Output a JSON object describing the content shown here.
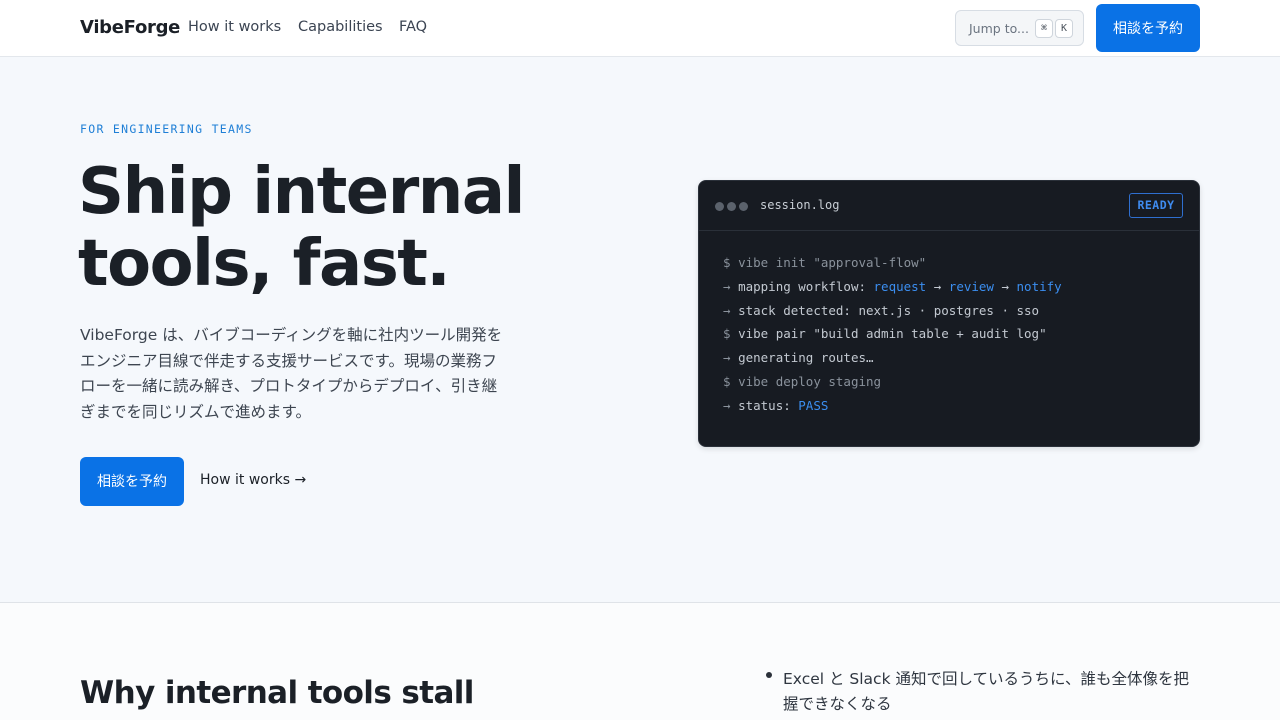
{
  "header": {
    "brand": "VibeForge",
    "nav": [
      "How it works",
      "Capabilities",
      "FAQ"
    ],
    "jump": {
      "label": "Jump to...",
      "key1": "⌘",
      "key2": "K"
    },
    "cta": "相談を予約"
  },
  "hero": {
    "eyebrow": "FOR ENGINEERING TEAMS",
    "title_line1": "Ship internal",
    "title_line2": "tools, fast.",
    "description": "VibeForge は、バイブコーディングを軸に社内ツール開発をエンジニア目線で伴走する支援サービスです。現場の業務フローを一緒に読み解き、プロトタイプからデプロイ、引き継ぎまでを同じリズムで進めます。",
    "primary_button": "相談を予約",
    "secondary_link": "How it works →"
  },
  "terminal": {
    "filename": "session.log",
    "status": "READY",
    "lines": [
      {
        "parts": [
          {
            "t": "$ ",
            "c": "mut"
          },
          {
            "t": "vibe init \"approval-flow\"",
            "c": "mut"
          }
        ]
      },
      {
        "parts": [
          {
            "t": "→ ",
            "c": "mut"
          },
          {
            "t": "mapping workflow: ",
            "c": ""
          },
          {
            "t": "request",
            "c": "acc"
          },
          {
            "t": " → ",
            "c": ""
          },
          {
            "t": "review",
            "c": "acc"
          },
          {
            "t": " → ",
            "c": ""
          },
          {
            "t": "notify",
            "c": "acc"
          }
        ]
      },
      {
        "parts": [
          {
            "t": "→ ",
            "c": "mut"
          },
          {
            "t": "stack detected: next.js · postgres · sso",
            "c": ""
          }
        ]
      },
      {
        "parts": [
          {
            "t": "$ ",
            "c": "mut"
          },
          {
            "t": "vibe pair \"build admin table + audit log\"",
            "c": ""
          }
        ]
      },
      {
        "parts": [
          {
            "t": "→ ",
            "c": "mut"
          },
          {
            "t": "generating routes…",
            "c": ""
          }
        ]
      },
      {
        "parts": [
          {
            "t": "$ ",
            "c": "mut"
          },
          {
            "t": "vibe deploy staging",
            "c": "mut"
          }
        ]
      },
      {
        "parts": [
          {
            "t": "→ ",
            "c": "mut"
          },
          {
            "t": "status: ",
            "c": ""
          },
          {
            "t": "PASS",
            "c": "acc"
          }
        ]
      }
    ]
  },
  "why": {
    "title": "Why internal tools stall",
    "bullet1": "Excel と Slack 通知で回しているうちに、誰も全体像を把握できなくなる"
  },
  "colors": {
    "accent": "#0a72e6",
    "terminal_bg": "#171b22",
    "link_blue": "#3b8ef0"
  }
}
